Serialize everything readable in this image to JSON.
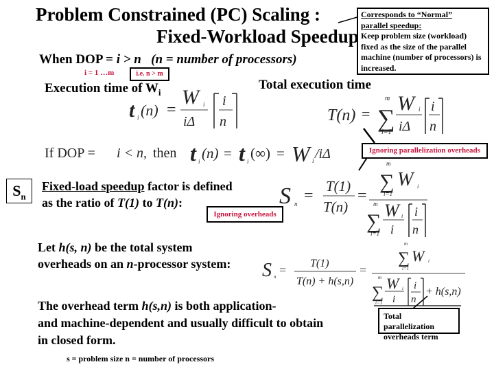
{
  "slide": {
    "title_line1": "Problem Constrained (PC) Scaling :",
    "title_line2": "Fixed-Workload Speedup",
    "condition": {
      "prefix": "When  DOP = ",
      "expr": "i > n",
      "note": "(n = number of processors)"
    },
    "range_label": "i = 1 …m",
    "ie_box": "i.e. n > m",
    "callout_normal": {
      "heading_line1": "Corresponds to “Normal”",
      "heading_line2": "parallel speedup:",
      "body": "Keep problem size (workload) fixed as the size of the parallel machine (number of processors) is increased."
    },
    "exec_time_label": "Execution time of W",
    "exec_time_sub": "i",
    "total_exec_label": "Total execution time",
    "ignoring_parallelization_label": "Ignoring parallelization overheads",
    "sn_box": {
      "main": "S",
      "sub": "n"
    },
    "fixed_load_line1_underlined": "Fixed-load speedup",
    "fixed_load_line1_rest": " factor is defined",
    "fixed_load_line2_prefix": "as the ratio of ",
    "fixed_load_t1": "T(1)",
    "fixed_load_to": " to ",
    "fixed_load_tn": "T(n)",
    "fixed_load_colon": ":",
    "ignoring_overheads_label": "Ignoring overheads",
    "let_line1_prefix": "Let  ",
    "let_line1_expr": "h(s, n)",
    "let_line1_rest": "  be the total system",
    "let_line2_prefix": "overheads on an ",
    "let_line2_expr": "n",
    "let_line2_rest": "-processor system:",
    "overhead_line1_prefix": "The overhead term ",
    "overhead_line1_expr": "h(s,n)",
    "overhead_line1_rest": "  is both application-",
    "overhead_line2": "and machine-dependent and usually difficult to obtain",
    "overhead_line3": "in closed form.",
    "legend": "s = problem size   n = number of processors",
    "total_parallelization_label": "Total parallelization overheads term"
  },
  "formulas": {
    "ti": {
      "lhs_t": "t",
      "lhs_sub": "i",
      "lhs_arg": "(n)",
      "eq": "=",
      "num_w": "W",
      "num_sub": "i",
      "den": "iΔ",
      "ceil_num": "i",
      "ceil_den": "n"
    },
    "Tn": {
      "lhs": "T(n)",
      "eq": "=",
      "sum": "∑",
      "sum_top": "m",
      "sum_bot": "i=1",
      "num_w": "W",
      "num_sub": "i",
      "den": "iΔ",
      "ceil_num": "i",
      "ceil_den": "n"
    },
    "if_line": {
      "if": "If  DOP = ",
      "cond": "i < n,",
      "then": " then ",
      "t": "t",
      "sub": "i",
      "arg1": "(n)",
      "eq": "=",
      "arg2": "(∞)",
      "w": "W",
      "wsub": "i",
      "rest": "/iΔ"
    },
    "sn1": {
      "S": "S",
      "sub": "n",
      "eq": "=",
      "num": "T(1)",
      "den": "T(n)",
      "sum": "∑",
      "sum_top": "m",
      "sum_bot": "i=1",
      "W": "W",
      "wsub": "i",
      "den_i": "i",
      "ceil_num": "i",
      "ceil_den": "n"
    },
    "sn2": {
      "S": "S",
      "sub": "n",
      "eq": "=",
      "num": "T(1)",
      "den": "T(n) + h(s,n)",
      "sum": "∑",
      "sum_top": "m",
      "sum_bot": "i=1",
      "W": "W",
      "wsub": "i",
      "den_i": "i",
      "ceil_num": "i",
      "ceil_den": "n",
      "plus_h": "+ h(s,n)"
    }
  },
  "colors": {
    "annotation_red": "#c8143c",
    "text": "#000000",
    "background": "#ffffff",
    "formula_gray": "#222222"
  }
}
